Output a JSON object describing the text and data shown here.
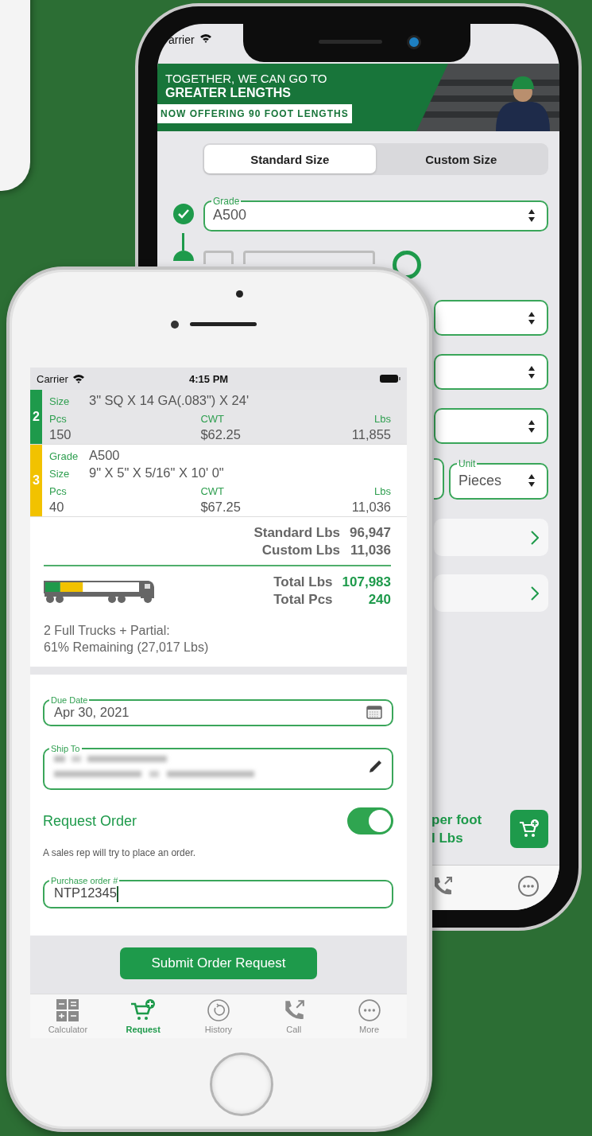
{
  "back_phone": {
    "status_bar": {
      "carrier": "arrier"
    },
    "banner": {
      "headline": "TOGETHER, WE CAN GO TO",
      "headline_bold": "GREATER LENGTHS",
      "tagline": "NOW OFFERING 90 FOOT LENGTHS"
    },
    "segments": [
      {
        "label": "Standard Size",
        "selected": true
      },
      {
        "label": "Custom Size",
        "selected": false
      }
    ],
    "grade_field": {
      "label": "Grade",
      "value": "A500",
      "done": true
    },
    "unit_field": {
      "label": "Unit",
      "value": "Pieces"
    },
    "summary": {
      "line_1": "per foot",
      "line_2": "l Lbs"
    }
  },
  "front_phone": {
    "status_bar": {
      "carrier": "Carrier",
      "time": "4:15 PM"
    },
    "items": [
      {
        "number": "2",
        "color": "#1e9a4b",
        "selected": true,
        "fields": [
          {
            "label": "Size",
            "value": "3\" SQ X 14 GA(.083\") X 24'"
          }
        ],
        "pcs_label": "Pcs",
        "pcs": "150",
        "cwt_label": "CWT",
        "cwt": "$62.25",
        "lbs_label": "Lbs",
        "lbs": "11,855"
      },
      {
        "number": "3",
        "color": "#f2c200",
        "selected": false,
        "fields": [
          {
            "label": "Grade",
            "value": "A500"
          },
          {
            "label": "Size",
            "value": "9\" X 5\" X 5/16\" X 10' 0\""
          }
        ],
        "pcs_label": "Pcs",
        "pcs": "40",
        "cwt_label": "CWT",
        "cwt": "$67.25",
        "lbs_label": "Lbs",
        "lbs": "11,036"
      }
    ],
    "subtotals": [
      {
        "label": "Standard Lbs",
        "value": "96,947"
      },
      {
        "label": "Custom Lbs",
        "value": "11,036"
      }
    ],
    "truck_load": [
      {
        "color": "#1e9a4b",
        "level": 0.16
      },
      {
        "color": "#f2c200",
        "level": 0.24
      }
    ],
    "totals": [
      {
        "label": "Total Lbs",
        "value": "107,983"
      },
      {
        "label": "Total Pcs",
        "value": "240"
      }
    ],
    "load_note": [
      "2 Full Trucks + Partial:",
      "61% Remaining (27,017 Lbs)"
    ],
    "due_date": {
      "label": "Due Date",
      "value": "Apr 30, 2021"
    },
    "ship_to": {
      "label": "Ship To"
    },
    "request_order": {
      "title": "Request Order",
      "subtitle": "A sales rep will try to place an order.",
      "on": true
    },
    "purchase_order": {
      "label": "Purchase order #",
      "value": "NTP12345"
    },
    "submit_button": "Submit Order Request",
    "tabs": [
      {
        "label": "Calculator",
        "selected": false
      },
      {
        "label": "Request",
        "selected": true
      },
      {
        "label": "History",
        "selected": false
      },
      {
        "label": "Call",
        "selected": false
      },
      {
        "label": "More",
        "selected": false
      }
    ]
  }
}
